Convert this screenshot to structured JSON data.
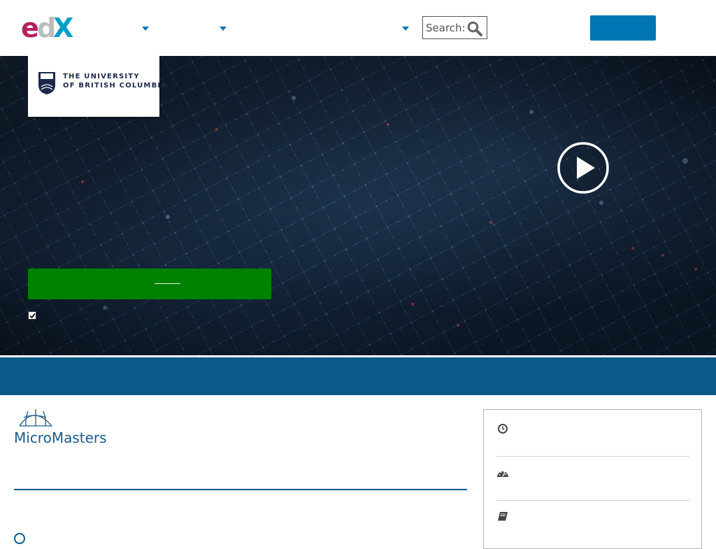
{
  "header": {
    "logo": "edX",
    "nav_dropdowns": [
      "",
      "",
      ""
    ],
    "search": {
      "placeholder": "Search:",
      "icon": "search-icon"
    },
    "signup_label": "",
    "accent_color": "#0075b4"
  },
  "hero": {
    "partner_logo_text": [
      "THE UNIVERSITY",
      "OF BRITISH COLUMBIA"
    ],
    "play_icon": "play-circle-icon",
    "enroll_label": "",
    "enroll_color": "#008100",
    "optin_checked": true
  },
  "banner": {
    "color": "#0b5a8a"
  },
  "program": {
    "logo_text": "MicroMasters",
    "info_rows": [
      {
        "icon": "clock-icon",
        "value": ""
      },
      {
        "icon": "gauge-icon",
        "value": ""
      },
      {
        "icon": "book-icon",
        "value": ""
      }
    ]
  }
}
